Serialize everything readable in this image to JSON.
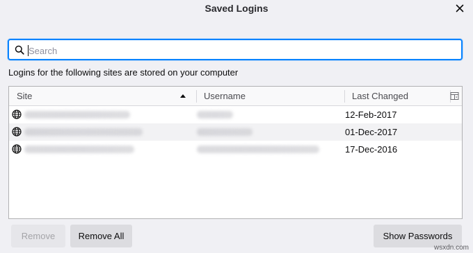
{
  "dialog": {
    "title": "Saved Logins",
    "close_icon": "close-icon"
  },
  "search": {
    "placeholder": "Search",
    "value": ""
  },
  "info_text": "Logins for the following sites are stored on your computer",
  "table": {
    "columns": [
      {
        "label": "Site",
        "sorted": "ascending"
      },
      {
        "label": "Username"
      },
      {
        "label": "Last Changed"
      }
    ],
    "rows": [
      {
        "site": "[blurred]",
        "username": "[blurred]",
        "last_changed": "12-Feb-2017"
      },
      {
        "site": "[blurred]",
        "username": "[blurred]",
        "last_changed": "01-Dec-2017"
      },
      {
        "site": "[blurred]",
        "username": "[blurred]",
        "last_changed": "17-Dec-2016"
      }
    ]
  },
  "buttons": {
    "remove": "Remove",
    "remove_all": "Remove All",
    "show_passwords": "Show Passwords"
  },
  "watermark": "wsxdn.com",
  "colors": {
    "focus_ring": "#0a84ff",
    "background": "#f0f0f4",
    "alt_row": "#f2f2f4"
  }
}
